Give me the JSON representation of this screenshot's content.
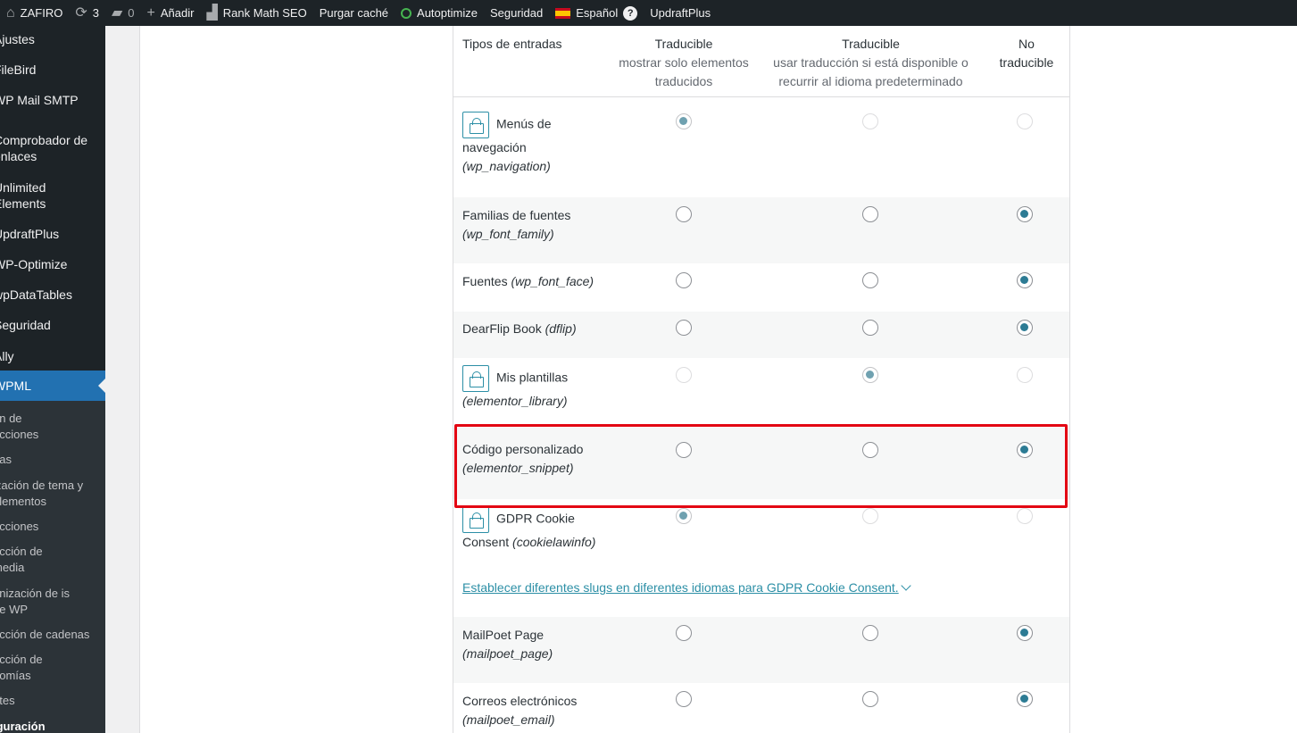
{
  "adminbar": {
    "site_name": "ZAFIRO",
    "updates_count": "3",
    "comments_count": "0",
    "add_new": "Añadir",
    "rank_math": "Rank Math SEO",
    "purge_cache": "Purgar caché",
    "autoptimize": "Autoptimize",
    "security": "Seguridad",
    "language": "Español",
    "help_glyph": "?",
    "updraft": "UpdraftPlus"
  },
  "sidebar": {
    "items": [
      {
        "label": "Ajustes"
      },
      {
        "label": "FileBird"
      },
      {
        "label": "WP Mail SMTP"
      },
      {
        "label": "Comprobador de enlaces"
      },
      {
        "label": "Unlimited Elements"
      },
      {
        "label": "UpdraftPlus"
      },
      {
        "label": "WP-Optimize"
      },
      {
        "label": "wpDataTables"
      },
      {
        "label": "Seguridad"
      },
      {
        "label": "Ally"
      },
      {
        "label": "WPML"
      }
    ],
    "submenu": [
      {
        "label": "ón de ucciones"
      },
      {
        "label": "nas"
      },
      {
        "label": "ización de tema y plementos"
      },
      {
        "label": "ucciones"
      },
      {
        "label": "ucción de media"
      },
      {
        "label": "onización de is de WP"
      },
      {
        "label": "ucción de cadenas"
      },
      {
        "label": "ucción de nomías"
      },
      {
        "label": "etes"
      },
      {
        "label": "iguración"
      }
    ]
  },
  "table": {
    "col_type": "Tipos de entradas",
    "col1_title": "Traducible",
    "col1_sub": "mostrar solo elementos traducidos",
    "col2_title": "Traducible",
    "col2_sub": "usar traducción si está disponible o recurrir al idioma predeterminado",
    "col3_title": "No traducible",
    "rows": [
      {
        "name": "Menús de navegación",
        "slug": "(wp_navigation)",
        "locked": true,
        "selected": 1
      },
      {
        "name": "Familias de fuentes",
        "slug": "(wp_font_family)",
        "locked": false,
        "selected": 3
      },
      {
        "name": "Fuentes",
        "slug": "(wp_font_face)",
        "locked": false,
        "selected": 3
      },
      {
        "name": "DearFlip Book",
        "slug": "(dflip)",
        "locked": false,
        "selected": 3
      },
      {
        "name": "Mis plantillas",
        "slug": "(elementor_library)",
        "locked": true,
        "selected": 2
      },
      {
        "name": "Código personalizado",
        "slug": "(elementor_snippet)",
        "locked": false,
        "selected": 3
      },
      {
        "name": "GDPR Cookie Consent",
        "slug": "(cookielawinfo)",
        "locked": true,
        "selected": 1
      },
      {
        "name": "MailPoet Page",
        "slug": "(mailpoet_page)",
        "locked": false,
        "selected": 3
      },
      {
        "name": "Correos electrónicos",
        "slug": "(mailpoet_email)",
        "locked": false,
        "selected": 3
      }
    ],
    "slug_link": "Establecer diferentes slugs en diferentes idiomas para GDPR Cookie Consent."
  },
  "colors": {
    "adminbar": "#1d2327",
    "active_menu": "#2271b1",
    "radio_checked": "#2c7b94",
    "highlight": "#e30613"
  }
}
